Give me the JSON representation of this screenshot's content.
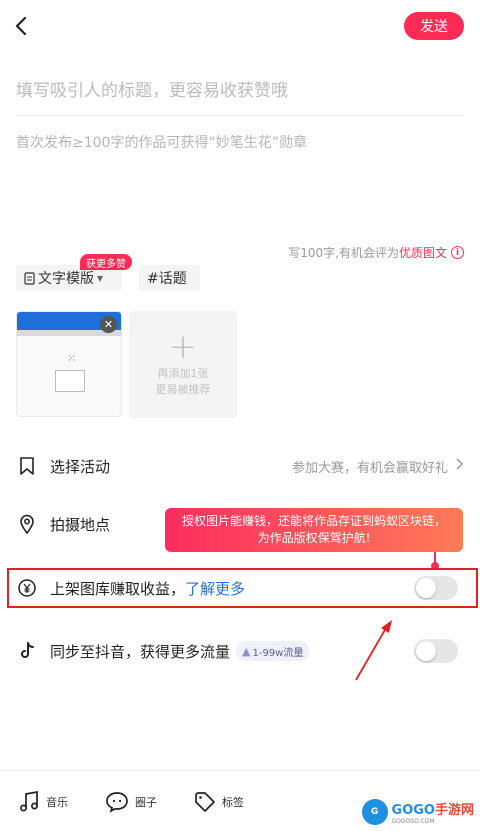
{
  "header": {
    "send_label": "发送"
  },
  "editor": {
    "title_placeholder": "填写吸引人的标题，更容易收获赞哦",
    "body_placeholder": "首次发布≥100字的作品可获得“妙笔生花”勋章",
    "hint_prefix": "写100字,有机会评为",
    "hint_highlight": "优质图文"
  },
  "chips": {
    "template_label": "文字模版",
    "topic_label": "#话题",
    "badge_label": "获更多赞"
  },
  "images": {
    "add_tile_line1": "再添加1张",
    "add_tile_line2": "更易被推荐"
  },
  "rows": {
    "activity_label": "选择活动",
    "activity_hint": "参加大赛，有机会赢取好礼",
    "location_label": "拍摄地点",
    "gallery_label": "上架图库赚取收益，",
    "gallery_link": "了解更多",
    "gallery_toggle_on": false,
    "douyin_label": "同步至抖音，获得更多流量",
    "douyin_badge": "1-99w流量",
    "douyin_toggle_on": false
  },
  "tooltip": {
    "line1": "授权图片能赚钱，还能将作品存证到蚂蚁区块链，",
    "line2": "为作品版权保驾护航!"
  },
  "toolbar": {
    "music_label": "音乐",
    "circle_label": "圈子",
    "tag_label": "标签"
  },
  "watermark": {
    "brand_main": "GOGO",
    "brand_cn": "手游网",
    "logo": "G",
    "sub": "GOGOSO.COM"
  },
  "colors": {
    "accent": "#fe2c55",
    "link": "#2a6fdb",
    "annotation_red": "#e52020"
  }
}
